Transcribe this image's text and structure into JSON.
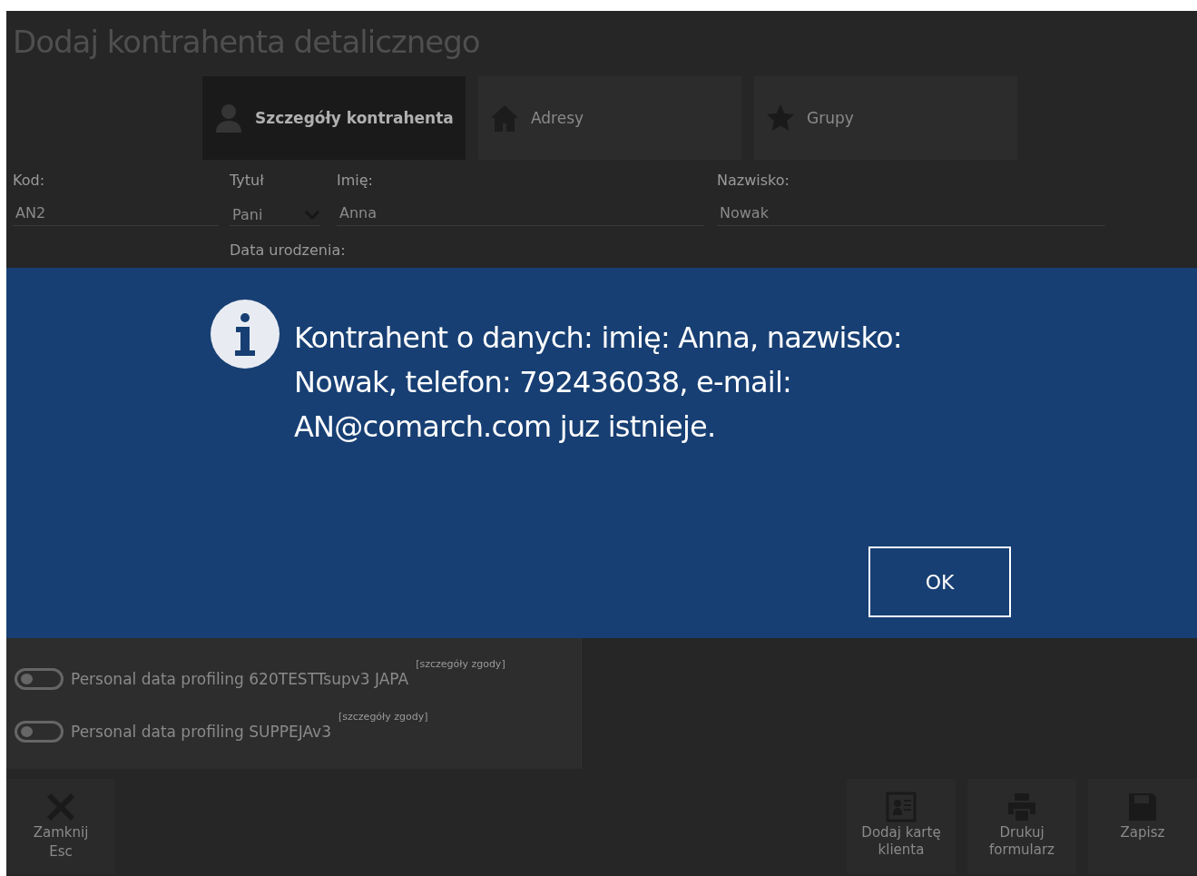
{
  "window": {
    "title": "Dodaj kontrahenta detalicznego"
  },
  "tabs": [
    {
      "label": "Szczegóły kontrahenta",
      "selected": true
    },
    {
      "label": "Adresy",
      "selected": false
    },
    {
      "label": "Grupy",
      "selected": false
    }
  ],
  "form": {
    "fields": [
      {
        "label": "Kod:",
        "value": "AN2",
        "kind": "text"
      },
      {
        "label": "Tytuł",
        "value": "Pani",
        "kind": "select"
      },
      {
        "label": "Imię:",
        "value": "Anna",
        "kind": "text"
      },
      {
        "label": "Nazwisko:",
        "value": "Nowak",
        "kind": "text"
      }
    ],
    "birth_date_label": "Data urodzenia:"
  },
  "dialog": {
    "message": "Kontrahent o danych: imię: Anna, nazwisko: Nowak, telefon: 792436038, e-mail: AN@comarch.com juz istnieje.",
    "button": "OK"
  },
  "consents": [
    {
      "label": "Personal data profiling 620TESTTsupv3 JAPA",
      "details": "[szczegóły zgody]",
      "on": false
    },
    {
      "label": "Personal data profiling SUPPEJAv3",
      "details": "[szczegóły zgody]",
      "on": false
    }
  ],
  "actions_left": [
    {
      "label": "Zamknij",
      "sublabel": "Esc"
    }
  ],
  "actions_right": [
    {
      "label": "Dodaj kartę klienta"
    },
    {
      "label": "Drukuj formularz"
    },
    {
      "label": "Zapisz"
    }
  ]
}
